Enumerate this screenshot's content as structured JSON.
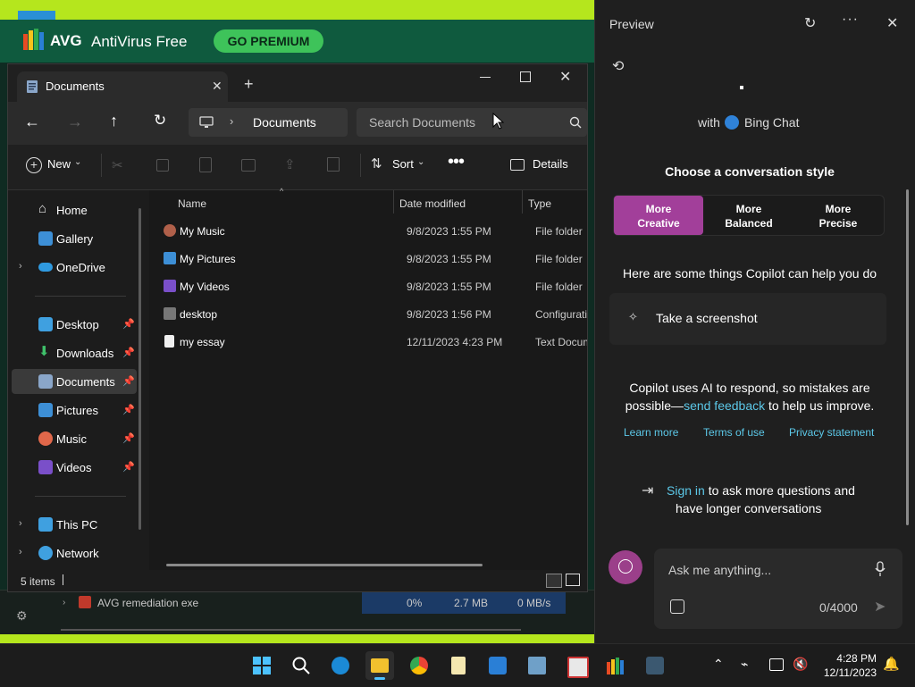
{
  "avg": {
    "logo_text": "AVG",
    "app_name": "AntiVirus Free",
    "premium_button": "GO PREMIUM",
    "process_row": {
      "name": "AVG remediation exe",
      "cpu": "0%",
      "memory": "2.7 MB",
      "disk": "0 MB/s"
    }
  },
  "explorer": {
    "tab_title": "Documents",
    "address": {
      "segment": "Documents"
    },
    "search": {
      "placeholder": "Search Documents"
    },
    "toolbar": {
      "new_label": "New",
      "sort_label": "Sort",
      "details_label": "Details"
    },
    "sidebar": {
      "items": [
        {
          "label": "Home"
        },
        {
          "label": "Gallery"
        },
        {
          "label": "OneDrive"
        },
        {
          "label": "Desktop"
        },
        {
          "label": "Downloads"
        },
        {
          "label": "Documents"
        },
        {
          "label": "Pictures"
        },
        {
          "label": "Music"
        },
        {
          "label": "Videos"
        },
        {
          "label": "This PC"
        },
        {
          "label": "Network"
        }
      ]
    },
    "columns": {
      "name": "Name",
      "date": "Date modified",
      "type": "Type"
    },
    "files": [
      {
        "name": "My Music",
        "date": "9/8/2023 1:55 PM",
        "type": "File folder"
      },
      {
        "name": "My Pictures",
        "date": "9/8/2023 1:55 PM",
        "type": "File folder"
      },
      {
        "name": "My Videos",
        "date": "9/8/2023 1:55 PM",
        "type": "File folder"
      },
      {
        "name": "desktop",
        "date": "9/8/2023 1:56 PM",
        "type": "Configuratio"
      },
      {
        "name": "my essay",
        "date": "12/11/2023 4:23 PM",
        "type": "Text Docume"
      }
    ],
    "status": {
      "count": "5 items"
    }
  },
  "copilot": {
    "header_title": "Preview",
    "with_label": "with",
    "bing_label": "Bing Chat",
    "style_heading": "Choose a conversation style",
    "styles": [
      {
        "line1": "More",
        "line2": "Creative"
      },
      {
        "line1": "More",
        "line2": "Balanced"
      },
      {
        "line1": "More",
        "line2": "Precise"
      }
    ],
    "help_heading": "Here are some things Copilot can help you do",
    "suggestion": "Take a screenshot",
    "disclaimer_line1": "Copilot uses AI to respond, so mistakes are",
    "disclaimer_pre": "possible—",
    "disclaimer_link": "send feedback",
    "disclaimer_post": " to help us improve.",
    "links": {
      "learn_more": "Learn more",
      "terms": "Terms of use",
      "privacy": "Privacy statement"
    },
    "signin_link": "Sign in",
    "signin_text": " to ask more questions and",
    "signin_text2": "have longer conversations",
    "input_placeholder": "Ask me anything...",
    "char_count": "0/4000"
  },
  "taskbar": {
    "time": "4:28 PM",
    "date": "12/11/2023"
  },
  "colors": {
    "avg_green": "#0f5a3e",
    "avg_lime": "#b5e61d",
    "premium_green": "#3ec35a",
    "creative_purple": "#a23f9a",
    "link_blue": "#5cc8e8"
  }
}
